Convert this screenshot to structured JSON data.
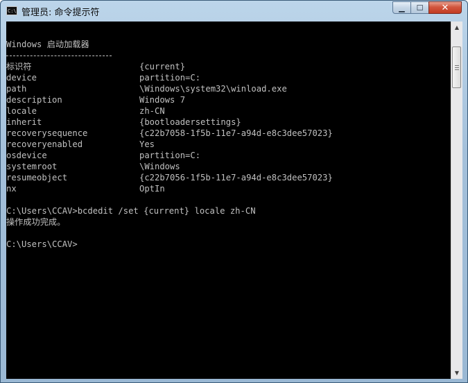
{
  "window": {
    "title": "管理员: 命令提示符",
    "icon": "cmd-icon",
    "icon_text": "C:\\",
    "controls": {
      "minimize": "minimize-icon",
      "maximize": "maximize-icon",
      "close": "close-icon"
    }
  },
  "console": {
    "header": "Windows 启动加载器",
    "rows": [
      {
        "key": "标识符",
        "value": "{current}"
      },
      {
        "key": "device",
        "value": "partition=C:"
      },
      {
        "key": "path",
        "value": "\\Windows\\system32\\winload.exe"
      },
      {
        "key": "description",
        "value": "Windows 7"
      },
      {
        "key": "locale",
        "value": "zh-CN"
      },
      {
        "key": "inherit",
        "value": "{bootloadersettings}"
      },
      {
        "key": "recoverysequence",
        "value": "{c22b7058-1f5b-11e7-a94d-e8c3dee57023}"
      },
      {
        "key": "recoveryenabled",
        "value": "Yes"
      },
      {
        "key": "osdevice",
        "value": "partition=C:"
      },
      {
        "key": "systemroot",
        "value": "\\Windows"
      },
      {
        "key": "resumeobject",
        "value": "{c22b7056-1f5b-11e7-a94d-e8c3dee57023}"
      },
      {
        "key": "nx",
        "value": "OptIn"
      }
    ],
    "command_line": "C:\\Users\\CCAV>bcdedit /set {current} locale zh-CN",
    "result": "操作成功完成。",
    "prompt": "C:\\Users\\CCAV>"
  },
  "colors": {
    "console_bg": "#000000",
    "console_fg": "#c0c0c0",
    "frame": "#a4c0da",
    "close": "#c23c22"
  }
}
